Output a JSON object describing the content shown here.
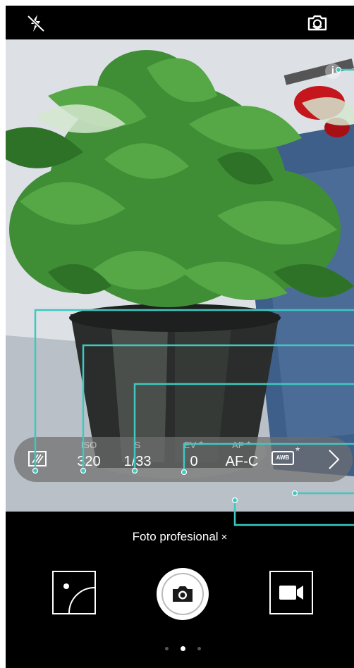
{
  "top_bar": {
    "flash_icon": "flash-off-icon",
    "switch_camera_icon": "switch-camera-icon"
  },
  "viewfinder": {
    "info_label": "i"
  },
  "pro_settings": {
    "metering_icon": "metering-mode-icon",
    "iso": {
      "label": "ISO",
      "value": "320"
    },
    "shutter": {
      "label": "S",
      "value": "1/33"
    },
    "ev": {
      "label": "EV",
      "value": "0"
    },
    "af": {
      "label": "AF",
      "value": "AF-C"
    },
    "awb_label": "AWB",
    "star": "★",
    "more_icon": "chevron-right-icon"
  },
  "mode": {
    "label": "Foto profesional",
    "close_symbol": "×"
  },
  "controls": {
    "gallery_icon": "gallery-thumbnail-icon",
    "shutter_icon": "camera-icon",
    "video_icon": "video-camera-icon"
  },
  "pagination": {
    "count": 3,
    "active": 1
  },
  "colors": {
    "callout": "#3ec8c0",
    "settings_bar": "#6e6e6e",
    "background": "#000000"
  }
}
